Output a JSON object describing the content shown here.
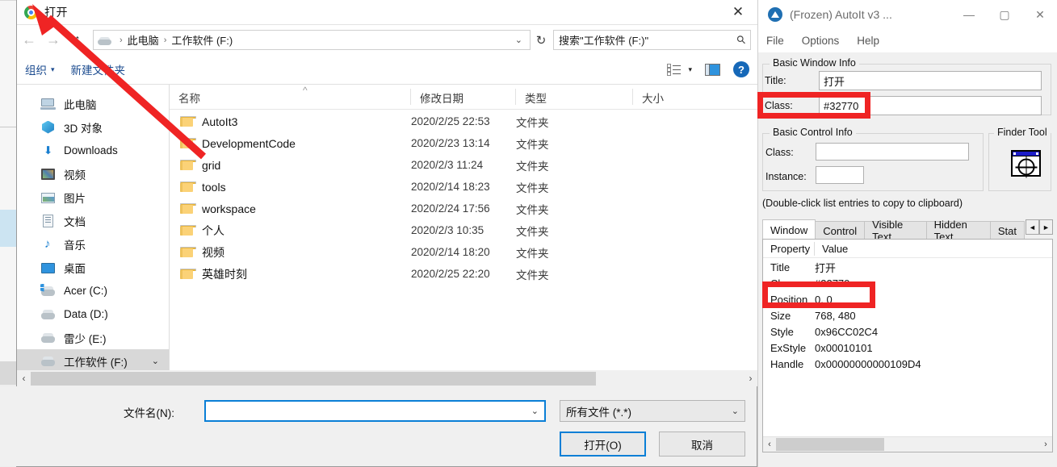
{
  "dialog": {
    "title": "打开",
    "close_label": "✕",
    "nav": {
      "back": "←",
      "forward": "→",
      "up": "↑"
    },
    "address": {
      "drive_icon": "drive-icon",
      "crumbs": [
        "此电脑",
        "工作软件 (F:)"
      ],
      "separator": "›",
      "chevron": "⌄",
      "refresh": "↻"
    },
    "search": {
      "placeholder": "搜索\"工作软件 (F:)\"",
      "icon": "search-icon"
    },
    "command_bar": {
      "organize": "组织",
      "organize_caret": "▾",
      "new_folder": "新建文件夹",
      "view_icon": "view-list-icon",
      "view_caret": "▾",
      "preview_icon": "preview-pane-icon",
      "help_icon": "?"
    },
    "nav_pane": {
      "items": [
        {
          "label": "此电脑",
          "icon": "this-pc-icon",
          "selected": false
        },
        {
          "label": "3D 对象",
          "icon": "3d-objects-icon",
          "selected": false
        },
        {
          "label": "Downloads",
          "icon": "downloads-icon",
          "selected": false
        },
        {
          "label": "视频",
          "icon": "videos-icon",
          "selected": false
        },
        {
          "label": "图片",
          "icon": "pictures-icon",
          "selected": false
        },
        {
          "label": "文档",
          "icon": "documents-icon",
          "selected": false
        },
        {
          "label": "音乐",
          "icon": "music-icon",
          "selected": false
        },
        {
          "label": "桌面",
          "icon": "desktop-icon",
          "selected": false
        },
        {
          "label": "Acer (C:)",
          "icon": "system-drive-icon",
          "selected": false
        },
        {
          "label": "Data (D:)",
          "icon": "drive-icon",
          "selected": false
        },
        {
          "label": "雷少 (E:)",
          "icon": "drive-icon",
          "selected": false
        },
        {
          "label": "工作软件 (F:)",
          "icon": "drive-icon",
          "selected": true
        }
      ],
      "expand_chevron": "⌄"
    },
    "file_list": {
      "columns": [
        "名称",
        "修改日期",
        "类型",
        "大小"
      ],
      "sort_mark": "^",
      "rows": [
        {
          "name": "AutoIt3",
          "date": "2020/2/25 22:53",
          "type": "文件夹",
          "size": ""
        },
        {
          "name": "DevelopmentCode",
          "date": "2020/2/23 13:14",
          "type": "文件夹",
          "size": ""
        },
        {
          "name": "grid",
          "date": "2020/2/3 11:24",
          "type": "文件夹",
          "size": ""
        },
        {
          "name": "tools",
          "date": "2020/2/14 18:23",
          "type": "文件夹",
          "size": ""
        },
        {
          "name": "workspace",
          "date": "2020/2/24 17:56",
          "type": "文件夹",
          "size": ""
        },
        {
          "name": "个人",
          "date": "2020/2/3 10:35",
          "type": "文件夹",
          "size": ""
        },
        {
          "name": "视频",
          "date": "2020/2/14 18:20",
          "type": "文件夹",
          "size": ""
        },
        {
          "name": "英雄时刻",
          "date": "2020/2/25 22:20",
          "type": "文件夹",
          "size": ""
        }
      ]
    },
    "hscroll": {
      "left": "‹",
      "right": "›"
    },
    "footer": {
      "filename_label": "文件名(N):",
      "filename_value": "",
      "filename_chevron": "⌄",
      "filter_value": "所有文件 (*.*)",
      "filter_chevron": "⌄",
      "open_button": "打开(O)",
      "cancel_button": "取消"
    }
  },
  "autoit": {
    "title": "(Frozen) AutoIt v3 ...",
    "logo_icon": "autoit-logo-icon",
    "controls": {
      "minimize": "—",
      "maximize": "▢",
      "close": "✕"
    },
    "menu": [
      "File",
      "Options",
      "Help"
    ],
    "basic_window_info": {
      "legend": "Basic Window Info",
      "title_label": "Title:",
      "title_value": "打开",
      "class_label": "Class:",
      "class_value": "#32770"
    },
    "basic_control_info": {
      "legend": "Basic Control Info",
      "class_label": "Class:",
      "class_value": "",
      "instance_label": "Instance:",
      "instance_value": ""
    },
    "finder_tool": {
      "legend": "Finder Tool",
      "icon": "finder-target-icon"
    },
    "hint": "(Double-click list entries to copy to clipboard)",
    "tabs": [
      {
        "label": "Window",
        "active": true
      },
      {
        "label": "Control",
        "active": false
      },
      {
        "label": "Visible Text",
        "active": false
      },
      {
        "label": "Hidden Text",
        "active": false
      },
      {
        "label": "Stat",
        "active": false
      }
    ],
    "tab_spinner": {
      "left": "◄",
      "right": "►"
    },
    "listview": {
      "headers": [
        "Property",
        "Value"
      ],
      "rows": [
        {
          "property": "Title",
          "value": "打开"
        },
        {
          "property": "Class",
          "value": "#32770"
        },
        {
          "property": "Position",
          "value": "0, 0"
        },
        {
          "property": "Size",
          "value": "768, 480"
        },
        {
          "property": "Style",
          "value": "0x96CC02C4"
        },
        {
          "property": "ExStyle",
          "value": "0x00010101"
        },
        {
          "property": "Handle",
          "value": "0x00000000000109D4"
        }
      ],
      "scroll": {
        "left": "‹",
        "right": "›"
      }
    }
  },
  "annotations": {
    "highlight_color": "#ef2424",
    "arrow_color": "#ef2424",
    "arrow_from": "DevelopmentCode row",
    "arrow_to": "dialog title 打开"
  }
}
